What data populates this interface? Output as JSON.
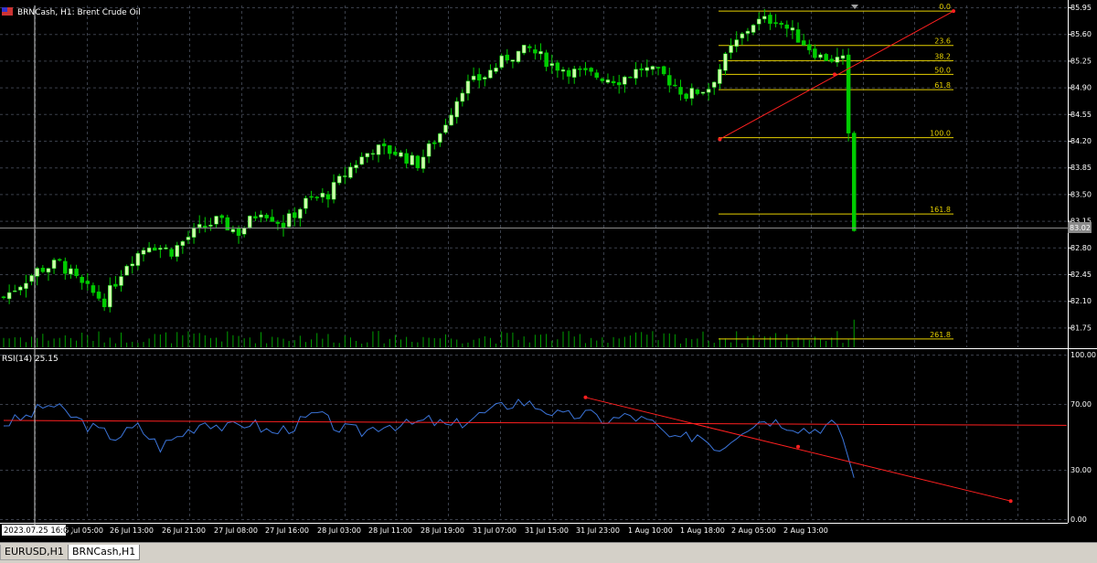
{
  "window": {
    "title": "BRNCash, H1:  Brent Crude Oil",
    "current_price": "83.02",
    "crosshair_time": "2023.07.25 16:00"
  },
  "tabs": [
    {
      "label": "EURUSD,H1",
      "active": false
    },
    {
      "label": "BRNCash,H1",
      "active": true
    }
  ],
  "colors": {
    "background": "#000000",
    "grid": "#3a3f4a",
    "bull_candle": "#ccffaa",
    "bear_candle": "#00cc00",
    "volume": "#00a000",
    "fibo": "#e6d000",
    "trendline": "#ff2020",
    "rsi_line": "#3b74d9",
    "axis_text": "#ffffff"
  },
  "chart_data": [
    {
      "type": "candlestick",
      "title": "BRNCash, H1:  Brent Crude Oil",
      "y_ticks": [
        "85.95",
        "85.60",
        "85.25",
        "84.90",
        "84.55",
        "84.20",
        "83.85",
        "83.50",
        "83.15",
        "82.80",
        "82.45",
        "82.10",
        "81.75"
      ],
      "ylim": [
        81.55,
        86.0
      ],
      "x_ticks": [
        "2023.07.25 16:00",
        "26 Jul 05:00",
        "26 Jul 13:00",
        "26 Jul 21:00",
        "27 Jul 08:00",
        "27 Jul 16:00",
        "28 Jul 03:00",
        "28 Jul 11:00",
        "28 Jul 19:00",
        "31 Jul 07:00",
        "31 Jul 15:00",
        "31 Jul 23:00",
        "1 Aug 10:00",
        "1 Aug 18:00",
        "2 Aug 05:00",
        "2 Aug 13:00"
      ],
      "current_price": 83.02,
      "close_path": [
        [
          0,
          82.15
        ],
        [
          6,
          82.5
        ],
        [
          10,
          82.6
        ],
        [
          14,
          82.3
        ],
        [
          18,
          82.1
        ],
        [
          22,
          82.6
        ],
        [
          26,
          82.85
        ],
        [
          30,
          82.75
        ],
        [
          34,
          83.0
        ],
        [
          38,
          83.15
        ],
        [
          42,
          83.0
        ],
        [
          46,
          83.3
        ],
        [
          50,
          83.1
        ],
        [
          54,
          83.4
        ],
        [
          58,
          83.5
        ],
        [
          62,
          83.85
        ],
        [
          66,
          84.1
        ],
        [
          70,
          84.05
        ],
        [
          74,
          83.9
        ],
        [
          78,
          84.3
        ],
        [
          82,
          84.9
        ],
        [
          86,
          85.05
        ],
        [
          90,
          85.3
        ],
        [
          94,
          85.4
        ],
        [
          98,
          85.2
        ],
        [
          102,
          85.1
        ],
        [
          106,
          85.05
        ],
        [
          110,
          85.0
        ],
        [
          114,
          85.15
        ],
        [
          118,
          85.05
        ],
        [
          122,
          84.8
        ],
        [
          126,
          84.9
        ],
        [
          130,
          85.4
        ],
        [
          134,
          85.75
        ],
        [
          138,
          85.8
        ],
        [
          142,
          85.55
        ],
        [
          146,
          85.3
        ],
        [
          150,
          85.25
        ],
        [
          151,
          84.3
        ],
        [
          152,
          83.02
        ]
      ],
      "candle_count": 153,
      "fibonacci": {
        "levels": [
          {
            "label": "0.0",
            "price": 85.9
          },
          {
            "label": "23.6",
            "price": 85.45
          },
          {
            "label": "38.2",
            "price": 85.25
          },
          {
            "label": "50.0",
            "price": 85.07
          },
          {
            "label": "61.8",
            "price": 84.87
          },
          {
            "label": "100.0",
            "price": 84.24
          },
          {
            "label": "161.8",
            "price": 83.24
          },
          {
            "label": "261.8",
            "price": 81.6
          }
        ]
      },
      "trendlines": [
        {
          "from": {
            "bar": 128,
            "price": 84.22
          },
          "to": {
            "bar": 152,
            "price": 85.9
          }
        }
      ]
    },
    {
      "type": "line",
      "title": "RSI(14) 25.15",
      "series": [
        {
          "name": "RSI(14)",
          "value": 25.15
        }
      ],
      "y_ticks": [
        "100.00",
        "70.00",
        "30.00",
        "0.00"
      ],
      "ylim": [
        0,
        100
      ],
      "rsi_path": [
        [
          0,
          58
        ],
        [
          4,
          62
        ],
        [
          8,
          70
        ],
        [
          12,
          63
        ],
        [
          16,
          55
        ],
        [
          20,
          50
        ],
        [
          24,
          56
        ],
        [
          28,
          44
        ],
        [
          32,
          52
        ],
        [
          36,
          60
        ],
        [
          40,
          55
        ],
        [
          44,
          59
        ],
        [
          48,
          52
        ],
        [
          52,
          57
        ],
        [
          56,
          64
        ],
        [
          60,
          55
        ],
        [
          64,
          53
        ],
        [
          68,
          58
        ],
        [
          72,
          57
        ],
        [
          76,
          60
        ],
        [
          80,
          56
        ],
        [
          84,
          62
        ],
        [
          88,
          67
        ],
        [
          92,
          72
        ],
        [
          96,
          68
        ],
        [
          100,
          62
        ],
        [
          104,
          64
        ],
        [
          108,
          60
        ],
        [
          112,
          63
        ],
        [
          116,
          58
        ],
        [
          120,
          47
        ],
        [
          124,
          52
        ],
        [
          128,
          43
        ],
        [
          132,
          55
        ],
        [
          136,
          61
        ],
        [
          140,
          58
        ],
        [
          144,
          54
        ],
        [
          148,
          58
        ],
        [
          150,
          50
        ],
        [
          152,
          25.15
        ]
      ],
      "levels": [
        {
          "from": {
            "bar": 0,
            "value": 60
          },
          "to": {
            "bar": 190,
            "value": 57
          }
        },
        {
          "from": {
            "bar": 104,
            "value": 74
          },
          "to": {
            "bar": 180,
            "value": 11
          }
        }
      ],
      "marker": {
        "bar": 142,
        "value": 44
      }
    }
  ]
}
